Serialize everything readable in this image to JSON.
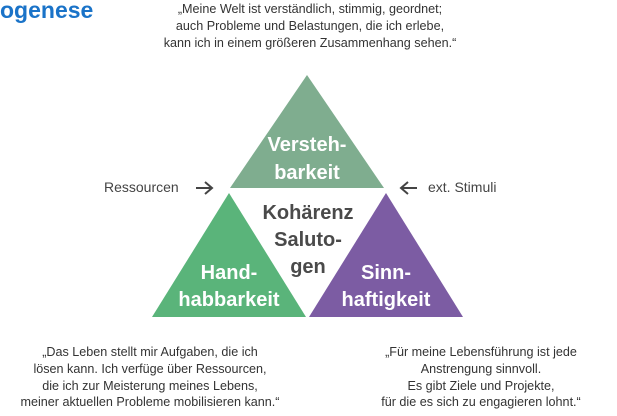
{
  "title": "ogenese",
  "quotes": {
    "top": [
      "„Meine Welt ist verständlich, stimmig, geordnet;",
      "auch Probleme und Belastungen, die ich erlebe,",
      "kann ich in einem größeren Zusammenhang sehen.“"
    ],
    "left": [
      "„Das Leben stellt mir Aufgaben, die ich",
      "lösen kann. Ich verfüge über Ressourcen,",
      "die ich zur Meisterung meines Lebens,",
      "meiner aktuellen Probleme mobilisieren kann.“"
    ],
    "right": [
      "„Für meine Lebensführung ist jede",
      "Anstrengung sinnvoll.",
      "Es gibt Ziele und Projekte,",
      "für die es sich zu engagieren lohnt.“"
    ]
  },
  "triangles": {
    "top": {
      "lines": [
        "Versteh-",
        "barkeit"
      ],
      "color": "#7fad8f"
    },
    "left": {
      "lines": [
        "Hand-",
        "habbarkeit"
      ],
      "color": "#5ab47a"
    },
    "right": {
      "lines": [
        "Sinn-",
        "haftigkeit"
      ],
      "color": "#7c5ca3"
    }
  },
  "center": {
    "lines": [
      "Kohärenz",
      "Saluto-",
      "gen"
    ]
  },
  "inputs": {
    "left": {
      "label": "Ressourcen",
      "icon": "arrow-right-icon"
    },
    "right": {
      "label": "ext. Stimuli",
      "icon": "arrow-left-icon"
    }
  }
}
